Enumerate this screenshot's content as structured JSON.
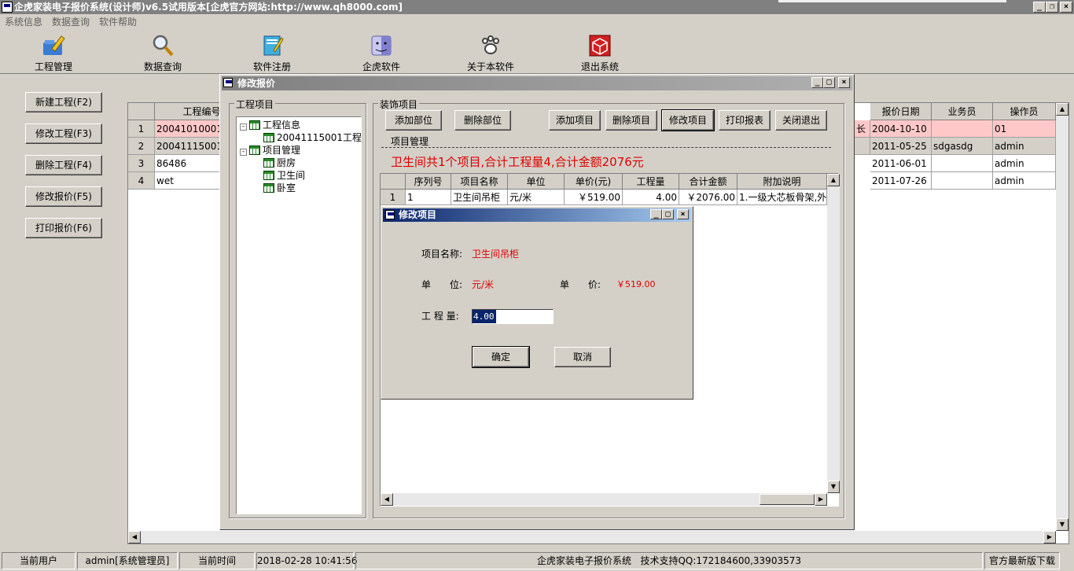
{
  "window": {
    "title": "企虎家装电子报价系统(设计师)v6.5试用版本[企虎官方网站:http://www.qh8000.com]"
  },
  "menu": [
    "系统信息",
    "数据查询",
    "软件帮助"
  ],
  "toolbar": [
    {
      "label": "工程管理",
      "icon": "folder-pencil-icon"
    },
    {
      "label": "数据查询",
      "icon": "magnifier-icon"
    },
    {
      "label": "软件注册",
      "icon": "register-icon"
    },
    {
      "label": "企虎软件",
      "icon": "finder-icon"
    },
    {
      "label": "关于本软件",
      "icon": "paw-icon"
    },
    {
      "label": "退出系统",
      "icon": "exit-cube-icon"
    }
  ],
  "side_buttons": [
    "新建工程(F2)",
    "修改工程(F3)",
    "删除工程(F4)",
    "修改报价(F5)",
    "打印报价(F6)"
  ],
  "main_grid": {
    "headers": [
      "工程编号",
      "报价日期",
      "业务员",
      "操作员"
    ],
    "rows": [
      {
        "num": "1",
        "code": "20041010001",
        "date": "2004-10-10",
        "sales": "",
        "op": "01",
        "extra": "长"
      },
      {
        "num": "2",
        "code": "20041115001",
        "date": "2011-05-25",
        "sales": "sdgasdg",
        "op": "admin",
        "extra": ""
      },
      {
        "num": "3",
        "code": "86486",
        "date": "2011-06-01",
        "sales": "",
        "op": "admin",
        "extra": ""
      },
      {
        "num": "4",
        "code": "wet",
        "date": "2011-07-26",
        "sales": "",
        "op": "admin",
        "extra": ""
      }
    ]
  },
  "dialog": {
    "title": "修改报价",
    "group_left": "工程项目",
    "group_right": "装饰项目",
    "tree": {
      "root1": "工程信息",
      "child1": "20041115001工程",
      "root2": "项目管理",
      "rooms": [
        "厨房",
        "卫生间",
        "卧室"
      ]
    },
    "buttons": [
      "添加部位",
      "删除部位",
      "添加项目",
      "删除项目",
      "修改项目",
      "打印报表",
      "关闭退出"
    ],
    "section_label": "项目管理",
    "summary": "卫生间共1个项目,合计工程量4,合计金额2076元",
    "grid": {
      "headers": [
        "序列号",
        "项目名称",
        "单位",
        "单价(元)",
        "工程量",
        "合计金额",
        "附加说明"
      ],
      "rows": [
        {
          "num": "1",
          "seq": "1",
          "name": "卫生间吊柜",
          "unit": "元/米",
          "price": "￥519.00",
          "qty": "4.00",
          "total": "￥2076.00",
          "note": "1.一级大芯板骨架,外"
        }
      ]
    }
  },
  "subdialog": {
    "title": "修改项目",
    "name_label": "项目名称:",
    "name_value": "卫生间吊柜",
    "unit_label": "单　　位:",
    "unit_value": "元/米",
    "price_label": "单　　价:",
    "price_value": "￥519.00",
    "qty_label": "工 程 量:",
    "qty_value": "4.00",
    "ok": "确定",
    "cancel": "取消"
  },
  "status": {
    "user_label": "当前用户",
    "user_value": "admin[系统管理员]",
    "time_label": "当前时间",
    "time_value": "2018-02-28 10:41:56",
    "product": "企虎家装电子报价系统",
    "support": "技术支持QQ:172184600,33903573",
    "update": "官方最新版下载"
  }
}
